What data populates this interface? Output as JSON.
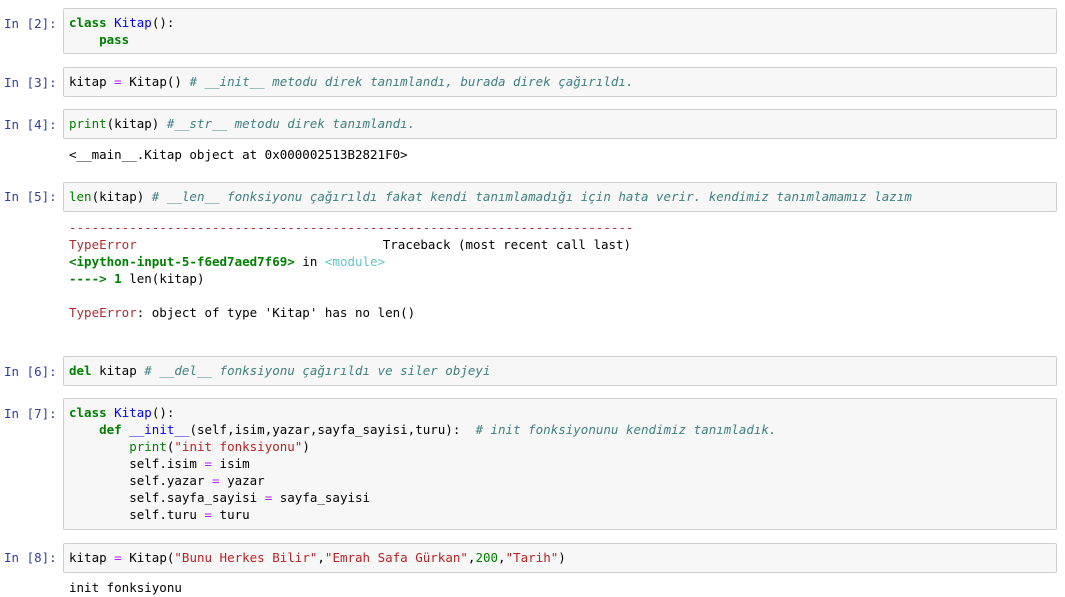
{
  "cells": {
    "c2": {
      "prompt": "In [2]:",
      "kw": "class",
      "name": "Kitap",
      "punct": "():",
      "kw2": "pass"
    },
    "c3": {
      "prompt": "In [3]:",
      "var": "kitap",
      "op": "=",
      "call": "Kitap()",
      "comment": "# __init__ metodu direk tanımlandı, burada direk çağırıldı."
    },
    "c4": {
      "prompt": "In [4]:",
      "fn": "print",
      "args": "(kitap)",
      "comment": "#__str__ metodu direk tanımlandı.",
      "output": "<__main__.Kitap object at 0x000002513B2821F0>"
    },
    "c5": {
      "prompt": "In [5]:",
      "fn": "len",
      "args": "(kitap)",
      "comment": "# __len__ fonksiyonu çağırıldı fakat kendi tanımlamadığı için hata verir. kendimiz tanımlamamız lazım",
      "dashes": "---------------------------------------------------------------------------",
      "err_type": "TypeError",
      "traceback": "Traceback (most recent call last)",
      "input_ref": "<ipython-input-5-f6ed7aed7f69>",
      "in_word": " in ",
      "module": "<module>",
      "arrow": "----> 1 ",
      "arrow_code": "len(kitap)",
      "err_msg": ": object of type 'Kitap' has no len()"
    },
    "c6": {
      "prompt": "In [6]:",
      "kw": "del",
      "var": "kitap",
      "comment": "# __del__ fonksiyonu çağırıldı ve siler objeyi"
    },
    "c7": {
      "prompt": "In [7]:",
      "kw": "class",
      "name": "Kitap",
      "punct": "():",
      "def_kw": "def",
      "init": "__init__",
      "params": "(self,isim,yazar,sayfa_sayisi,turu):",
      "comment": "# init fonksiyonunu kendimiz tanımladık.",
      "print_fn": "print",
      "print_str": "\"init fonksiyonu\"",
      "l1a": "self.isim",
      "l1b": "isim",
      "l2a": "self.yazar",
      "l2b": "yazar",
      "l3a": "self.sayfa_sayisi",
      "l3b": "sayfa_sayisi",
      "l4a": "self.turu",
      "l4b": "turu"
    },
    "c8": {
      "prompt": "In [8]:",
      "var": "kitap",
      "call": "Kitap(",
      "s1": "\"Bunu Herkes Bilir\"",
      "s2": "\"Emrah Safa Gürkan\"",
      "n": "200",
      "s3": "\"Tarih\"",
      "output": "init fonksiyonu"
    }
  }
}
